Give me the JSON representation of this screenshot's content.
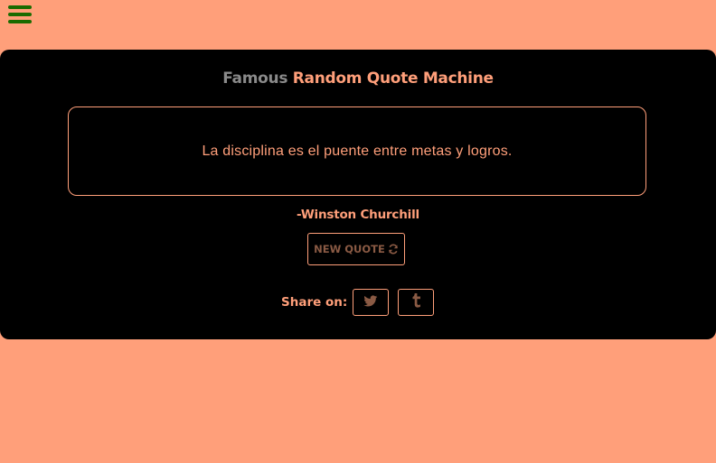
{
  "nav": {
    "menu_icon": "hamburger-menu-icon"
  },
  "card": {
    "title_part1": "Famous",
    "title_part2": "Random Quote Machine",
    "quote": "La disciplina es el puente entre metas y logros.",
    "author": "-Winston Churchill",
    "new_quote_label": "NEW QUOTE",
    "new_quote_icon": "refresh-icon",
    "share_label": "Share on:",
    "share_buttons": [
      {
        "icon": "twitter-icon"
      },
      {
        "icon": "tumblr-icon"
      }
    ]
  },
  "colors": {
    "page_bg": "#ff9f7a",
    "card_bg": "#000000",
    "accent": "#ff9f7a",
    "muted_title": "#8a8a8a",
    "menu_icon": "#1a6b00",
    "button_text": "#8a5a44"
  }
}
